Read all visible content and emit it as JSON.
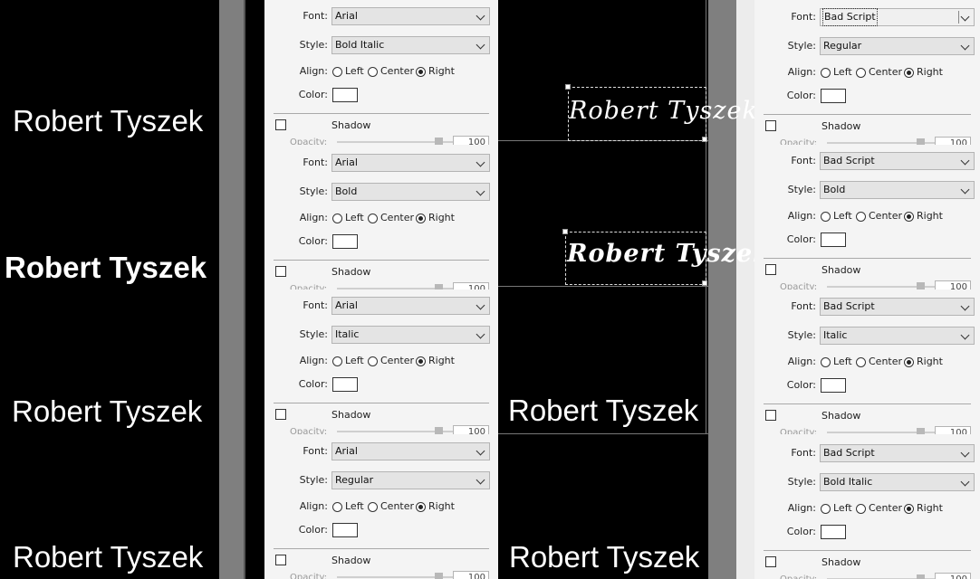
{
  "name_text": "Robert Tyszek",
  "labels": {
    "font": "Font:",
    "style": "Style:",
    "align": "Align:",
    "color": "Color:",
    "left": "Left",
    "center": "Center",
    "right": "Right",
    "shadow": "Shadow",
    "opacity": "Opacity:"
  },
  "panels": [
    {
      "font": "Arial",
      "style": "Bold Italic",
      "align": "Right",
      "opacity": "100"
    },
    {
      "font": "Arial",
      "style": "Bold",
      "align": "Right",
      "opacity": "100"
    },
    {
      "font": "Arial",
      "style": "Italic",
      "align": "Right",
      "opacity": "100"
    },
    {
      "font": "Arial",
      "style": "Regular",
      "align": "Right",
      "opacity": "100"
    },
    {
      "font": "Bad Script",
      "style": "Regular",
      "align": "Right",
      "opacity": "100"
    },
    {
      "font": "Bad Script",
      "style": "Bold",
      "align": "Right",
      "opacity": "100"
    },
    {
      "font": "Bad Script",
      "style": "Italic",
      "align": "Right",
      "opacity": "100"
    },
    {
      "font": "Bad Script",
      "style": "Bold Italic",
      "align": "Right",
      "opacity": "100"
    }
  ],
  "colors": {
    "canvas": "#000000",
    "panel": "#f4f4f4",
    "gutter": "#7f7f7f",
    "text": "#ffffff"
  }
}
